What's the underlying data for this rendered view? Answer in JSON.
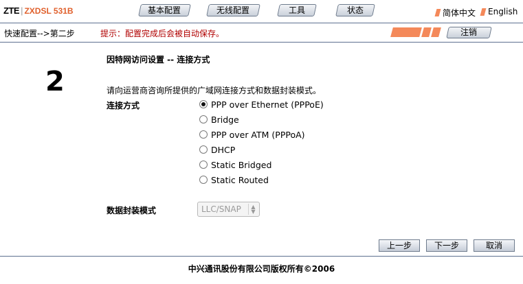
{
  "brand": {
    "logo": "ZTE",
    "separator": "|",
    "model": "ZXDSL 531B"
  },
  "nav": {
    "tabs": [
      {
        "label": "基本配置"
      },
      {
        "label": "无线配置"
      },
      {
        "label": "工具"
      },
      {
        "label": "状态"
      }
    ]
  },
  "language": {
    "chinese": "简体中文",
    "english": "English"
  },
  "breadcrumb": "快速配置-->第二步",
  "hint": "提示：配置完成后会被自动保存。",
  "logout_label": "注销",
  "page": {
    "title": "因特网访问设置 -- 连接方式",
    "step_number": "2",
    "description": "请向运营商咨询所提供的广域网连接方式和数据封装模式。",
    "connection_label": "连接方式",
    "options": [
      {
        "label": "PPP over Ethernet (PPPoE)",
        "checked": true
      },
      {
        "label": "Bridge",
        "checked": false
      },
      {
        "label": "PPP over ATM (PPPoA)",
        "checked": false
      },
      {
        "label": "DHCP",
        "checked": false
      },
      {
        "label": "Static Bridged",
        "checked": false
      },
      {
        "label": "Static Routed",
        "checked": false
      }
    ],
    "encap_label": "数据封装模式",
    "encap_value": "LLC/SNAP"
  },
  "buttons": {
    "prev": "上一步",
    "next": "下一步",
    "cancel": "取消"
  },
  "footer": "中兴通讯股份有限公司版权所有©2006",
  "colors": {
    "accent": "#f4895a",
    "model_text": "#e0602c",
    "hint_text": "#b00000",
    "rule": "#5c6f8f"
  }
}
